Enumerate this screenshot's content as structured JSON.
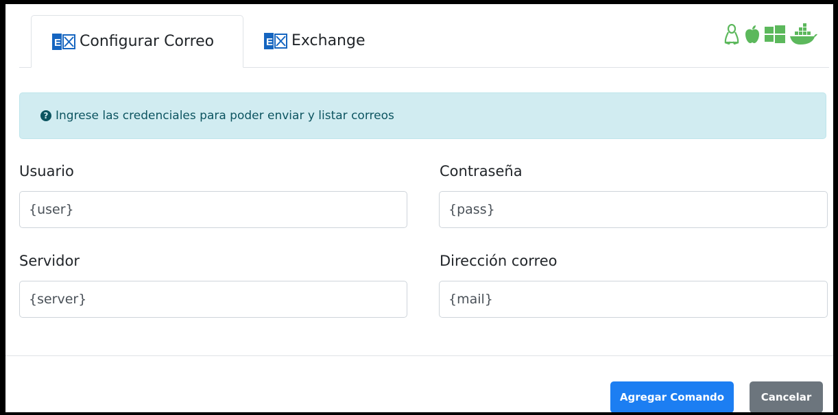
{
  "tabs": [
    {
      "label": "Configurar Correo",
      "active": true,
      "icon": "exchange-icon"
    },
    {
      "label": "Exchange",
      "active": false,
      "icon": "exchange-icon"
    }
  ],
  "platform_icons": [
    "linux-icon",
    "apple-icon",
    "windows-icon",
    "docker-icon"
  ],
  "accent_colors": {
    "platform": "#5cb85c",
    "exchange": "#1565c0",
    "primary": "#1c7ef2",
    "secondary": "#6c757d",
    "alert_bg": "#d1ecf1"
  },
  "alert": {
    "icon": "question-circle-icon",
    "text": "Ingrese las credenciales para poder enviar y listar correos"
  },
  "form": {
    "usuario": {
      "label": "Usuario",
      "value": "{user}"
    },
    "contrasena": {
      "label": "Contraseña",
      "value": "{pass}"
    },
    "servidor": {
      "label": "Servidor",
      "value": "{server}"
    },
    "direccion": {
      "label": "Dirección correo",
      "value": "{mail}"
    }
  },
  "footer": {
    "primary_label": "Agregar Comando",
    "secondary_label": "Cancelar"
  }
}
